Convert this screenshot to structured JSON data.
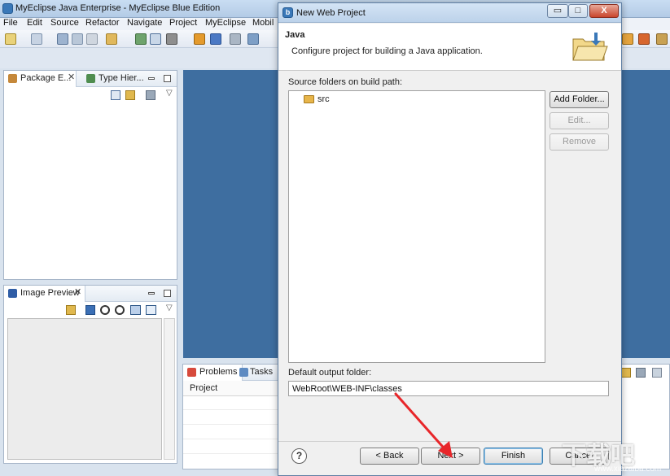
{
  "background_window": {
    "title": "MyEclipse Java Enterprise - MyEclipse Blue Edition",
    "menu": [
      "File",
      "Edit",
      "Source",
      "Refactor",
      "Navigate",
      "Project",
      "MyEclipse",
      "Mobil"
    ]
  },
  "views": {
    "package_explorer_tab": "Package E...",
    "type_hierarchy_tab": "Type Hier...",
    "image_preview_tab": "Image Preview",
    "problems_tab": "Problems",
    "tasks_tab": "Tasks",
    "problems_column": "Project"
  },
  "dialog": {
    "title": "New Web Project",
    "header_title": "Java",
    "header_description": "Configure project for building a Java application.",
    "source_label": "Source folders on build path:",
    "source_folders": [
      "src"
    ],
    "buttons": {
      "add_folder": "Add Folder...",
      "edit": "Edit...",
      "remove": "Remove"
    },
    "output_label": "Default output folder:",
    "output_value": "WebRoot\\WEB-INF\\classes",
    "footer": {
      "help": "?",
      "back": "< Back",
      "next": "Next >",
      "finish": "Finish",
      "cancel": "Cancel"
    },
    "window_buttons": {
      "minimize": "▭",
      "maximize": "□",
      "close": "X"
    }
  },
  "watermark": {
    "text": "下载吧",
    "sub": "www.xiazaiba.com"
  },
  "colors": {
    "workbench_blue": "#3e6ea0",
    "dialog_bg": "#f0f0f0",
    "annotation_arrow": "#e8262a"
  }
}
